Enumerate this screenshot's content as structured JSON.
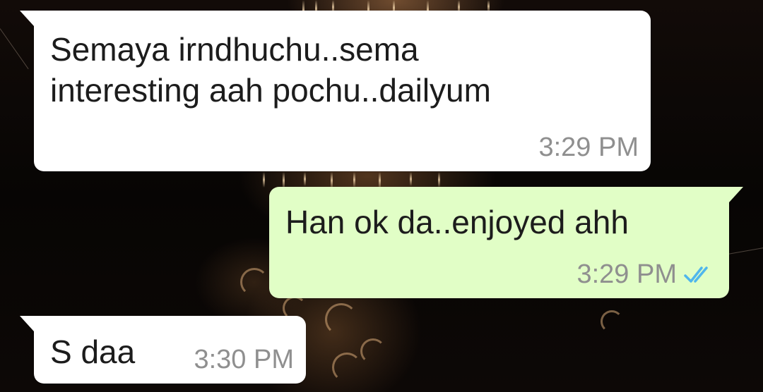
{
  "colors": {
    "incoming_bubble": "#ffffff",
    "outgoing_bubble": "#e1fec6",
    "timestamp": "#8f8f8f",
    "read_ticks": "#4fb6ec"
  },
  "messages": [
    {
      "direction": "incoming",
      "text": "Semaya irndhuchu..sema\ninteresting aah pochu..dailyum",
      "time": "3:29 PM"
    },
    {
      "direction": "outgoing",
      "text": "Han ok da..enjoyed ahh",
      "time": "3:29 PM",
      "status_icon": "double-check-read-icon"
    },
    {
      "direction": "incoming",
      "text": "S daa",
      "time": "3:30 PM"
    }
  ]
}
